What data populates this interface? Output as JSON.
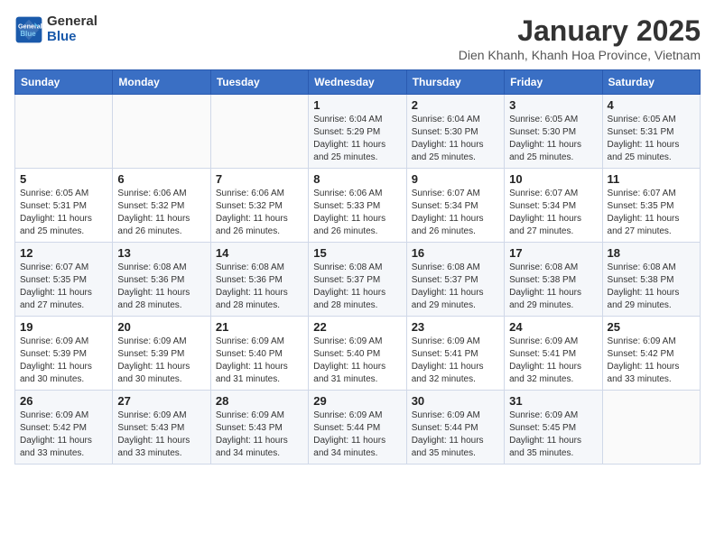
{
  "logo": {
    "line1": "General",
    "line2": "Blue"
  },
  "title": "January 2025",
  "subtitle": "Dien Khanh, Khanh Hoa Province, Vietnam",
  "weekdays": [
    "Sunday",
    "Monday",
    "Tuesday",
    "Wednesday",
    "Thursday",
    "Friday",
    "Saturday"
  ],
  "weeks": [
    [
      {
        "day": "",
        "info": ""
      },
      {
        "day": "",
        "info": ""
      },
      {
        "day": "",
        "info": ""
      },
      {
        "day": "1",
        "info": "Sunrise: 6:04 AM\nSunset: 5:29 PM\nDaylight: 11 hours\nand 25 minutes."
      },
      {
        "day": "2",
        "info": "Sunrise: 6:04 AM\nSunset: 5:30 PM\nDaylight: 11 hours\nand 25 minutes."
      },
      {
        "day": "3",
        "info": "Sunrise: 6:05 AM\nSunset: 5:30 PM\nDaylight: 11 hours\nand 25 minutes."
      },
      {
        "day": "4",
        "info": "Sunrise: 6:05 AM\nSunset: 5:31 PM\nDaylight: 11 hours\nand 25 minutes."
      }
    ],
    [
      {
        "day": "5",
        "info": "Sunrise: 6:05 AM\nSunset: 5:31 PM\nDaylight: 11 hours\nand 25 minutes."
      },
      {
        "day": "6",
        "info": "Sunrise: 6:06 AM\nSunset: 5:32 PM\nDaylight: 11 hours\nand 26 minutes."
      },
      {
        "day": "7",
        "info": "Sunrise: 6:06 AM\nSunset: 5:32 PM\nDaylight: 11 hours\nand 26 minutes."
      },
      {
        "day": "8",
        "info": "Sunrise: 6:06 AM\nSunset: 5:33 PM\nDaylight: 11 hours\nand 26 minutes."
      },
      {
        "day": "9",
        "info": "Sunrise: 6:07 AM\nSunset: 5:34 PM\nDaylight: 11 hours\nand 26 minutes."
      },
      {
        "day": "10",
        "info": "Sunrise: 6:07 AM\nSunset: 5:34 PM\nDaylight: 11 hours\nand 27 minutes."
      },
      {
        "day": "11",
        "info": "Sunrise: 6:07 AM\nSunset: 5:35 PM\nDaylight: 11 hours\nand 27 minutes."
      }
    ],
    [
      {
        "day": "12",
        "info": "Sunrise: 6:07 AM\nSunset: 5:35 PM\nDaylight: 11 hours\nand 27 minutes."
      },
      {
        "day": "13",
        "info": "Sunrise: 6:08 AM\nSunset: 5:36 PM\nDaylight: 11 hours\nand 28 minutes."
      },
      {
        "day": "14",
        "info": "Sunrise: 6:08 AM\nSunset: 5:36 PM\nDaylight: 11 hours\nand 28 minutes."
      },
      {
        "day": "15",
        "info": "Sunrise: 6:08 AM\nSunset: 5:37 PM\nDaylight: 11 hours\nand 28 minutes."
      },
      {
        "day": "16",
        "info": "Sunrise: 6:08 AM\nSunset: 5:37 PM\nDaylight: 11 hours\nand 29 minutes."
      },
      {
        "day": "17",
        "info": "Sunrise: 6:08 AM\nSunset: 5:38 PM\nDaylight: 11 hours\nand 29 minutes."
      },
      {
        "day": "18",
        "info": "Sunrise: 6:08 AM\nSunset: 5:38 PM\nDaylight: 11 hours\nand 29 minutes."
      }
    ],
    [
      {
        "day": "19",
        "info": "Sunrise: 6:09 AM\nSunset: 5:39 PM\nDaylight: 11 hours\nand 30 minutes."
      },
      {
        "day": "20",
        "info": "Sunrise: 6:09 AM\nSunset: 5:39 PM\nDaylight: 11 hours\nand 30 minutes."
      },
      {
        "day": "21",
        "info": "Sunrise: 6:09 AM\nSunset: 5:40 PM\nDaylight: 11 hours\nand 31 minutes."
      },
      {
        "day": "22",
        "info": "Sunrise: 6:09 AM\nSunset: 5:40 PM\nDaylight: 11 hours\nand 31 minutes."
      },
      {
        "day": "23",
        "info": "Sunrise: 6:09 AM\nSunset: 5:41 PM\nDaylight: 11 hours\nand 32 minutes."
      },
      {
        "day": "24",
        "info": "Sunrise: 6:09 AM\nSunset: 5:41 PM\nDaylight: 11 hours\nand 32 minutes."
      },
      {
        "day": "25",
        "info": "Sunrise: 6:09 AM\nSunset: 5:42 PM\nDaylight: 11 hours\nand 33 minutes."
      }
    ],
    [
      {
        "day": "26",
        "info": "Sunrise: 6:09 AM\nSunset: 5:42 PM\nDaylight: 11 hours\nand 33 minutes."
      },
      {
        "day": "27",
        "info": "Sunrise: 6:09 AM\nSunset: 5:43 PM\nDaylight: 11 hours\nand 33 minutes."
      },
      {
        "day": "28",
        "info": "Sunrise: 6:09 AM\nSunset: 5:43 PM\nDaylight: 11 hours\nand 34 minutes."
      },
      {
        "day": "29",
        "info": "Sunrise: 6:09 AM\nSunset: 5:44 PM\nDaylight: 11 hours\nand 34 minutes."
      },
      {
        "day": "30",
        "info": "Sunrise: 6:09 AM\nSunset: 5:44 PM\nDaylight: 11 hours\nand 35 minutes."
      },
      {
        "day": "31",
        "info": "Sunrise: 6:09 AM\nSunset: 5:45 PM\nDaylight: 11 hours\nand 35 minutes."
      },
      {
        "day": "",
        "info": ""
      }
    ]
  ]
}
